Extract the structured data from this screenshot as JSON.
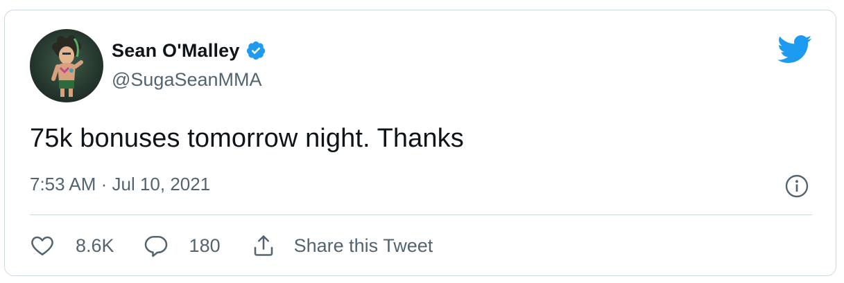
{
  "author": {
    "name": "Sean O'Malley",
    "handle": "@SugaSeanMMA",
    "verified": true,
    "avatar_icon": "avatar-cartoon-fighter"
  },
  "tweet": {
    "text": "75k bonuses tomorrow night. Thanks",
    "timestamp": "7:53 AM · Jul 10, 2021"
  },
  "actions": {
    "likes": "8.6K",
    "replies": "180",
    "share_label": "Share this Tweet"
  },
  "colors": {
    "brand": "#1d9bf0",
    "text_primary": "#0f1419",
    "text_secondary": "#536471",
    "border": "#cfd9de"
  },
  "icons": {
    "logo": "twitter-bird-icon",
    "info": "info-icon",
    "like": "heart-icon",
    "reply": "reply-bubble-icon",
    "share": "share-icon",
    "verified": "verified-badge-icon"
  }
}
